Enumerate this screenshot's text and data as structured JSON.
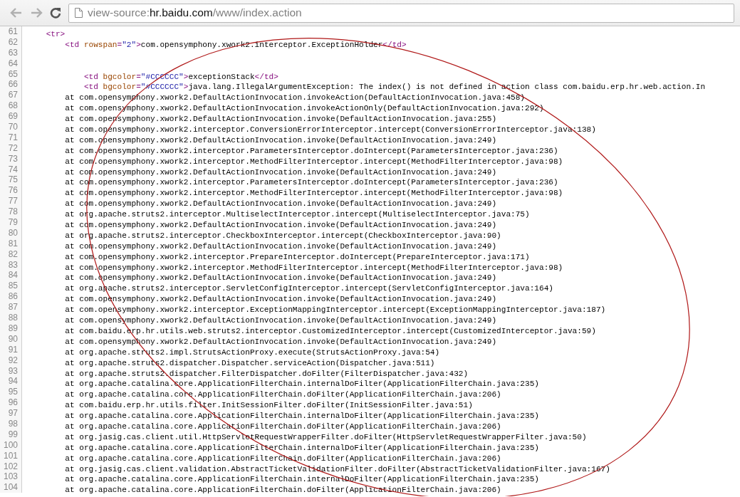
{
  "toolbar": {
    "url_parts": [
      {
        "text": "view-source:",
        "host": false
      },
      {
        "text": "hr.baidu.com",
        "host": true
      },
      {
        "text": "/www/index.action",
        "host": false
      }
    ]
  },
  "lines": [
    {
      "number": "61",
      "segments": [
        {
          "kind": "tag",
          "text": "    <tr>"
        }
      ]
    },
    {
      "number": "62",
      "segments": [
        {
          "kind": "tag",
          "text": "        <td "
        },
        {
          "kind": "attr",
          "text": "rowspan"
        },
        {
          "kind": "tag",
          "text": "="
        },
        {
          "kind": "value",
          "text": "\"2\""
        },
        {
          "kind": "tag",
          "text": ">"
        },
        {
          "kind": "text",
          "text": "com.opensymphony.xwork2.interceptor.ExceptionHolder"
        },
        {
          "kind": "tag",
          "text": "</td>"
        }
      ]
    },
    {
      "number": "63"
    },
    {
      "number": "64"
    },
    {
      "number": "65",
      "segments": [
        {
          "kind": "tag",
          "text": "            <td "
        },
        {
          "kind": "attr",
          "text": "bgcolor"
        },
        {
          "kind": "tag",
          "text": "="
        },
        {
          "kind": "value",
          "text": "\"#CCCCCC\""
        },
        {
          "kind": "tag",
          "text": ">"
        },
        {
          "kind": "text",
          "text": "exceptionStack"
        },
        {
          "kind": "tag",
          "text": "</td>"
        }
      ]
    },
    {
      "number": "66",
      "segments": [
        {
          "kind": "tag",
          "text": "            <td "
        },
        {
          "kind": "attr",
          "text": "bgcolor"
        },
        {
          "kind": "tag",
          "text": "="
        },
        {
          "kind": "value",
          "text": "\"#CCCCCC\""
        },
        {
          "kind": "tag",
          "text": ">"
        },
        {
          "kind": "text",
          "text": "java.lang.IllegalArgumentException: The index() is not defined in action class com.baidu.erp.hr.web.action.In"
        }
      ]
    },
    {
      "number": "67",
      "text": "        at com.opensymphony.xwork2.DefaultActionInvocation.invokeAction(DefaultActionInvocation.java:458)"
    },
    {
      "number": "68",
      "text": "        at com.opensymphony.xwork2.DefaultActionInvocation.invokeActionOnly(DefaultActionInvocation.java:292)"
    },
    {
      "number": "69",
      "text": "        at com.opensymphony.xwork2.DefaultActionInvocation.invoke(DefaultActionInvocation.java:255)"
    },
    {
      "number": "70",
      "text": "        at com.opensymphony.xwork2.interceptor.ConversionErrorInterceptor.intercept(ConversionErrorInterceptor.java:138)"
    },
    {
      "number": "71",
      "text": "        at com.opensymphony.xwork2.DefaultActionInvocation.invoke(DefaultActionInvocation.java:249)"
    },
    {
      "number": "72",
      "text": "        at com.opensymphony.xwork2.interceptor.ParametersInterceptor.doIntercept(ParametersInterceptor.java:236)"
    },
    {
      "number": "73",
      "text": "        at com.opensymphony.xwork2.interceptor.MethodFilterInterceptor.intercept(MethodFilterInterceptor.java:98)"
    },
    {
      "number": "74",
      "text": "        at com.opensymphony.xwork2.DefaultActionInvocation.invoke(DefaultActionInvocation.java:249)"
    },
    {
      "number": "75",
      "text": "        at com.opensymphony.xwork2.interceptor.ParametersInterceptor.doIntercept(ParametersInterceptor.java:236)"
    },
    {
      "number": "76",
      "text": "        at com.opensymphony.xwork2.interceptor.MethodFilterInterceptor.intercept(MethodFilterInterceptor.java:98)"
    },
    {
      "number": "77",
      "text": "        at com.opensymphony.xwork2.DefaultActionInvocation.invoke(DefaultActionInvocation.java:249)"
    },
    {
      "number": "78",
      "text": "        at org.apache.struts2.interceptor.MultiselectInterceptor.intercept(MultiselectInterceptor.java:75)"
    },
    {
      "number": "79",
      "text": "        at com.opensymphony.xwork2.DefaultActionInvocation.invoke(DefaultActionInvocation.java:249)"
    },
    {
      "number": "80",
      "text": "        at org.apache.struts2.interceptor.CheckboxInterceptor.intercept(CheckboxInterceptor.java:90)"
    },
    {
      "number": "81",
      "text": "        at com.opensymphony.xwork2.DefaultActionInvocation.invoke(DefaultActionInvocation.java:249)"
    },
    {
      "number": "82",
      "text": "        at com.opensymphony.xwork2.interceptor.PrepareInterceptor.doIntercept(PrepareInterceptor.java:171)"
    },
    {
      "number": "83",
      "text": "        at com.opensymphony.xwork2.interceptor.MethodFilterInterceptor.intercept(MethodFilterInterceptor.java:98)"
    },
    {
      "number": "84",
      "text": "        at com.opensymphony.xwork2.DefaultActionInvocation.invoke(DefaultActionInvocation.java:249)"
    },
    {
      "number": "85",
      "text": "        at org.apache.struts2.interceptor.ServletConfigInterceptor.intercept(ServletConfigInterceptor.java:164)"
    },
    {
      "number": "86",
      "text": "        at com.opensymphony.xwork2.DefaultActionInvocation.invoke(DefaultActionInvocation.java:249)"
    },
    {
      "number": "87",
      "text": "        at com.opensymphony.xwork2.interceptor.ExceptionMappingInterceptor.intercept(ExceptionMappingInterceptor.java:187)"
    },
    {
      "number": "88",
      "text": "        at com.opensymphony.xwork2.DefaultActionInvocation.invoke(DefaultActionInvocation.java:249)"
    },
    {
      "number": "89",
      "text": "        at com.baidu.erp.hr.utils.web.struts2.interceptor.CustomizedInterceptor.intercept(CustomizedInterceptor.java:59)"
    },
    {
      "number": "90",
      "text": "        at com.opensymphony.xwork2.DefaultActionInvocation.invoke(DefaultActionInvocation.java:249)"
    },
    {
      "number": "91",
      "text": "        at org.apache.struts2.impl.StrutsActionProxy.execute(StrutsActionProxy.java:54)"
    },
    {
      "number": "92",
      "text": "        at org.apache.struts2.dispatcher.Dispatcher.serviceAction(Dispatcher.java:511)"
    },
    {
      "number": "93",
      "text": "        at org.apache.struts2.dispatcher.FilterDispatcher.doFilter(FilterDispatcher.java:432)"
    },
    {
      "number": "94",
      "text": "        at org.apache.catalina.core.ApplicationFilterChain.internalDoFilter(ApplicationFilterChain.java:235)"
    },
    {
      "number": "95",
      "text": "        at org.apache.catalina.core.ApplicationFilterChain.doFilter(ApplicationFilterChain.java:206)"
    },
    {
      "number": "96",
      "text": "        at com.baidu.erp.hr.utils.filter.InitSessionFilter.doFilter(InitSessionFilter.java:51)"
    },
    {
      "number": "97",
      "text": "        at org.apache.catalina.core.ApplicationFilterChain.internalDoFilter(ApplicationFilterChain.java:235)"
    },
    {
      "number": "98",
      "text": "        at org.apache.catalina.core.ApplicationFilterChain.doFilter(ApplicationFilterChain.java:206)"
    },
    {
      "number": "99",
      "text": "        at org.jasig.cas.client.util.HttpServletRequestWrapperFilter.doFilter(HttpServletRequestWrapperFilter.java:50)"
    },
    {
      "number": "100",
      "text": "        at org.apache.catalina.core.ApplicationFilterChain.internalDoFilter(ApplicationFilterChain.java:235)"
    },
    {
      "number": "101",
      "text": "        at org.apache.catalina.core.ApplicationFilterChain.doFilter(ApplicationFilterChain.java:206)"
    },
    {
      "number": "102",
      "text": "        at org.jasig.cas.client.validation.AbstractTicketValidationFilter.doFilter(AbstractTicketValidationFilter.java:167)"
    },
    {
      "number": "103",
      "text": "        at org.apache.catalina.core.ApplicationFilterChain.internalDoFilter(ApplicationFilterChain.java:235)"
    },
    {
      "number": "104",
      "text": "        at org.apache.catalina.core.ApplicationFilterChain.doFilter(ApplicationFilterChain.java:206)"
    }
  ]
}
